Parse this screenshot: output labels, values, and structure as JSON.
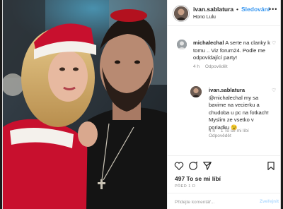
{
  "header": {
    "username": "ivan.sablatura",
    "separator": "•",
    "follow_label": "Sledování",
    "location": "Hono Lulu",
    "more_label": "•••"
  },
  "comments": [
    {
      "username": "michalechal",
      "text": "A serte na clanky k tomu .. Viz forum24. Podle me odpovídající party!",
      "time": "4 h",
      "reply_label": "Odpovědět",
      "likes_label": ""
    },
    {
      "username": "ivan.sablatura",
      "text": "@michalechal my sa bavime na vecierku a chudoba u pc na fotkach! Myslim ze vsetko v poriadku 😉",
      "time": "4 h",
      "likes_label": "1 To se mi líbí",
      "reply_label": "Odpovědět"
    }
  ],
  "actions": {
    "like_icon": "heart-icon",
    "comment_icon": "comment-icon",
    "share_icon": "share-icon",
    "save_icon": "bookmark-icon",
    "likes_text": "497 To se mi líbí",
    "date_text": "PŘED 1 D"
  },
  "comment_box": {
    "placeholder": "Přidejte komentář...",
    "post_label": "Zveřejnit"
  }
}
